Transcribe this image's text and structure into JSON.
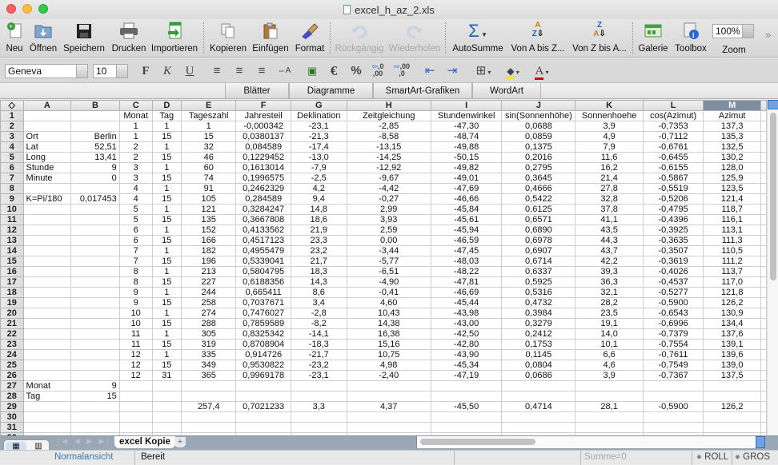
{
  "window": {
    "title": "excel_h_az_2.xls"
  },
  "toolbar": {
    "items": [
      {
        "label": "Neu",
        "icon": "new-document-icon"
      },
      {
        "label": "Öffnen",
        "icon": "open-folder-icon"
      },
      {
        "label": "Speichern",
        "icon": "save-disk-icon"
      },
      {
        "label": "Drucken",
        "icon": "printer-icon"
      },
      {
        "label": "Importieren",
        "icon": "import-icon"
      },
      {
        "label": "Kopieren",
        "icon": "copy-icon"
      },
      {
        "label": "Einfügen",
        "icon": "paste-icon"
      },
      {
        "label": "Format",
        "icon": "format-brush-icon"
      },
      {
        "label": "Rückgängig",
        "icon": "undo-icon"
      },
      {
        "label": "Wiederholen",
        "icon": "redo-icon"
      },
      {
        "label": "AutoSumme",
        "icon": "sigma-icon"
      },
      {
        "label": "Von A bis Z...",
        "icon": "sort-ascending-icon"
      },
      {
        "label": "Von Z bis A...",
        "icon": "sort-descending-icon"
      },
      {
        "label": "Galerie",
        "icon": "gallery-icon"
      },
      {
        "label": "Toolbox",
        "icon": "toolbox-icon"
      },
      {
        "label": "Zoom",
        "icon": "zoom-icon"
      }
    ],
    "zoom_value": "100%",
    "overflow": "»"
  },
  "format": {
    "font": "Geneva",
    "size": "10",
    "bold": "F",
    "italic": "K",
    "underline": "U",
    "currency": "€",
    "percent": "%",
    "text_color": "A",
    "fill_color_hex": "#f5e500",
    "font_color_hex": "#d0021b"
  },
  "ribbon": {
    "tabs": [
      "Blätter",
      "Diagramme",
      "SmartArt-Grafiken",
      "WordArt"
    ]
  },
  "sheet": {
    "corner": "◇",
    "columns": [
      "A",
      "B",
      "C",
      "D",
      "E",
      "F",
      "G",
      "H",
      "I",
      "J",
      "K",
      "L",
      "M"
    ],
    "selected_column": "M",
    "rows": [
      [
        "",
        "",
        "Monat",
        "Tag",
        "Tageszahl",
        "Jahresteil",
        "Deklination",
        "Zeitgleichung",
        "Stundenwinkel",
        "sin(Sonnenhöhe)",
        "Sonnenhoehe",
        "cos(Azimut)",
        "Azimut"
      ],
      [
        "",
        "",
        "1",
        "1",
        "1",
        "-0,000342",
        "-23,1",
        "-2,85",
        "-47,30",
        "0,0688",
        "3,9",
        "-0,7353",
        "137,3"
      ],
      [
        "Ort",
        "Berlin",
        "1",
        "15",
        "15",
        "0,0380137",
        "-21,3",
        "-8,58",
        "-48,74",
        "0,0859",
        "4,9",
        "-0,7112",
        "135,3"
      ],
      [
        "Lat",
        "52,51",
        "2",
        "1",
        "32",
        "0,084589",
        "-17,4",
        "-13,15",
        "-49,88",
        "0,1375",
        "7,9",
        "-0,6761",
        "132,5"
      ],
      [
        "Long",
        "13,41",
        "2",
        "15",
        "46",
        "0,1229452",
        "-13,0",
        "-14,25",
        "-50,15",
        "0,2016",
        "11,6",
        "-0,6455",
        "130,2"
      ],
      [
        "Stunde",
        "9",
        "3",
        "1",
        "60",
        "0,1613014",
        "-7,9",
        "-12,92",
        "-49,82",
        "0,2795",
        "16,2",
        "-0,6155",
        "128,0"
      ],
      [
        "Minute",
        "0",
        "3",
        "15",
        "74",
        "0,1996575",
        "-2,5",
        "-9,67",
        "-49,01",
        "0,3645",
        "21,4",
        "-0,5867",
        "125,9"
      ],
      [
        "",
        "",
        "4",
        "1",
        "91",
        "0,2462329",
        "4,2",
        "-4,42",
        "-47,69",
        "0,4666",
        "27,8",
        "-0,5519",
        "123,5"
      ],
      [
        "K=Pi/180",
        "0,017453",
        "4",
        "15",
        "105",
        "0,284589",
        "9,4",
        "-0,27",
        "-46,66",
        "0,5422",
        "32,8",
        "-0,5206",
        "121,4"
      ],
      [
        "",
        "",
        "5",
        "1",
        "121",
        "0,3284247",
        "14,8",
        "2,99",
        "-45,84",
        "0,6125",
        "37,8",
        "-0,4795",
        "118,7"
      ],
      [
        "",
        "",
        "5",
        "15",
        "135",
        "0,3667808",
        "18,6",
        "3,93",
        "-45,61",
        "0,6571",
        "41,1",
        "-0,4396",
        "116,1"
      ],
      [
        "",
        "",
        "6",
        "1",
        "152",
        "0,4133562",
        "21,9",
        "2,59",
        "-45,94",
        "0,6890",
        "43,5",
        "-0,3925",
        "113,1"
      ],
      [
        "",
        "",
        "6",
        "15",
        "166",
        "0,4517123",
        "23,3",
        "0,00",
        "-46,59",
        "0,6978",
        "44,3",
        "-0,3635",
        "111,3"
      ],
      [
        "",
        "",
        "7",
        "1",
        "182",
        "0,4955479",
        "23,2",
        "-3,44",
        "-47,45",
        "0,6907",
        "43,7",
        "-0,3507",
        "110,5"
      ],
      [
        "",
        "",
        "7",
        "15",
        "196",
        "0,5339041",
        "21,7",
        "-5,77",
        "-48,03",
        "0,6714",
        "42,2",
        "-0,3619",
        "111,2"
      ],
      [
        "",
        "",
        "8",
        "1",
        "213",
        "0,5804795",
        "18,3",
        "-6,51",
        "-48,22",
        "0,6337",
        "39,3",
        "-0,4026",
        "113,7"
      ],
      [
        "",
        "",
        "8",
        "15",
        "227",
        "0,6188356",
        "14,3",
        "-4,90",
        "-47,81",
        "0,5925",
        "36,3",
        "-0,4537",
        "117,0"
      ],
      [
        "",
        "",
        "9",
        "1",
        "244",
        "0,665411",
        "8,6",
        "-0,41",
        "-46,69",
        "0,5316",
        "32,1",
        "-0,5277",
        "121,8"
      ],
      [
        "",
        "",
        "9",
        "15",
        "258",
        "0,7037671",
        "3,4",
        "4,60",
        "-45,44",
        "0,4732",
        "28,2",
        "-0,5900",
        "126,2"
      ],
      [
        "",
        "",
        "10",
        "1",
        "274",
        "0,7476027",
        "-2,8",
        "10,43",
        "-43,98",
        "0,3984",
        "23,5",
        "-0,6543",
        "130,9"
      ],
      [
        "",
        "",
        "10",
        "15",
        "288",
        "0,7859589",
        "-8,2",
        "14,38",
        "-43,00",
        "0,3279",
        "19,1",
        "-0,6996",
        "134,4"
      ],
      [
        "",
        "",
        "11",
        "1",
        "305",
        "0,8325342",
        "-14,1",
        "16,38",
        "-42,50",
        "0,2412",
        "14,0",
        "-0,7379",
        "137,6"
      ],
      [
        "",
        "",
        "11",
        "15",
        "319",
        "0,8708904",
        "-18,3",
        "15,16",
        "-42,80",
        "0,1753",
        "10,1",
        "-0,7554",
        "139,1"
      ],
      [
        "",
        "",
        "12",
        "1",
        "335",
        "0,914726",
        "-21,7",
        "10,75",
        "-43,90",
        "0,1145",
        "6,6",
        "-0,7611",
        "139,6"
      ],
      [
        "",
        "",
        "12",
        "15",
        "349",
        "0,9530822",
        "-23,2",
        "4,98",
        "-45,34",
        "0,0804",
        "4,6",
        "-0,7549",
        "139,0"
      ],
      [
        "",
        "",
        "12",
        "31",
        "365",
        "0,9969178",
        "-23,1",
        "-2,40",
        "-47,19",
        "0,0686",
        "3,9",
        "-0,7367",
        "137,5"
      ],
      [
        "Monat",
        "9",
        "",
        "",
        "",
        "",
        "",
        "",
        "",
        "",
        "",
        "",
        ""
      ],
      [
        "Tag",
        "15",
        "",
        "",
        "",
        "",
        "",
        "",
        "",
        "",
        "",
        "",
        ""
      ],
      [
        "",
        "",
        "",
        "",
        "257,4",
        "0,7021233",
        "3,3",
        "4,37",
        "-45,50",
        "0,4714",
        "28,1",
        "-0,5900",
        "126,2"
      ],
      [
        "",
        "",
        "",
        "",
        "",
        "",
        "",
        "",
        "",
        "",
        "",
        "",
        ""
      ],
      [
        "",
        "",
        "",
        "",
        "",
        "",
        "",
        "",
        "",
        "",
        "",
        "",
        ""
      ],
      [
        "",
        "",
        "",
        "",
        "",
        "",
        "",
        "",
        "",
        "",
        "",
        "",
        ""
      ]
    ]
  },
  "sheet_tabs": {
    "active": "excel Kopie",
    "add": "+",
    "nav": "|◀ ◀ ▶ ▶|"
  },
  "statusbar": {
    "view": "Normalansicht",
    "state": "Bereit",
    "sum": "Summe=0",
    "scroll_lock": "ROLL",
    "caps_lock": "GROS"
  }
}
